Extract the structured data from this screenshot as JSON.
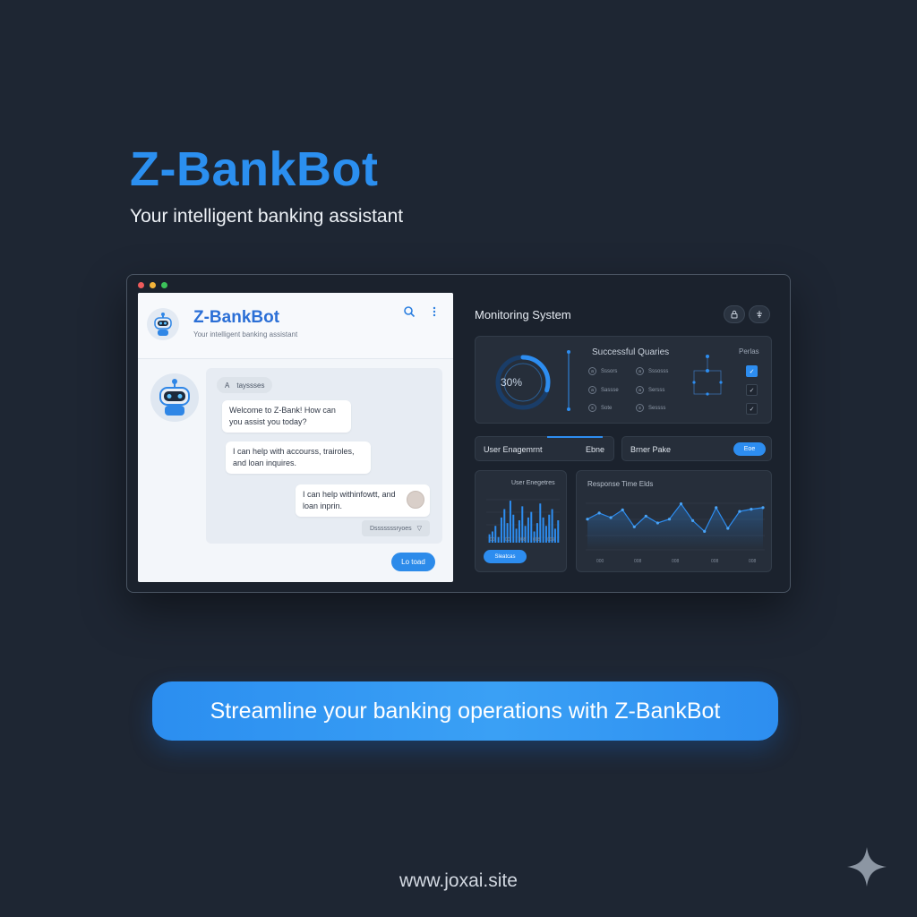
{
  "hero": {
    "title": "Z-BankBot",
    "subtitle": "Your intelligent banking assistant"
  },
  "window": {
    "traffic_light_colors": [
      "#ee5b5b",
      "#f3b43a",
      "#3cc25a"
    ]
  },
  "chat": {
    "title": "Z-BankBot",
    "subtitle": "Your intelligent banking assistant",
    "tag_icon": "A",
    "tag_label": "tayssses",
    "messages": [
      {
        "from": "bot",
        "text": "Welcome to Z-Bank! How can you assist you today?"
      },
      {
        "from": "bot",
        "text": "I can help with accourss, trairoles, and loan inquires."
      },
      {
        "from": "user",
        "text": "I can help withinfowtt, and loan inprin."
      }
    ],
    "status_label": "Dsssssssryoes",
    "status_chevron": "▽",
    "send_label": "Lo toad"
  },
  "monitor": {
    "title": "Monitoring System",
    "queries_card": {
      "title": "Successful Quaries",
      "side_label": "Perlas",
      "gauge_value": "30%",
      "gauge_fraction": 0.3,
      "left_items": [
        {
          "icon": "a",
          "label": "Sssors"
        },
        {
          "icon": "a",
          "label": "Sassse"
        },
        {
          "icon": "s",
          "label": "Sote"
        }
      ],
      "right_items": [
        {
          "icon": "a",
          "label": "Sssosss"
        },
        {
          "icon": "a",
          "label": "Sersss"
        },
        {
          "icon": "s",
          "label": "Sessss"
        }
      ]
    },
    "engagement_strip": {
      "label": "User Enagemrnt",
      "value": "Ebne"
    },
    "error_strip": {
      "label": "Brner Pake",
      "button": "Eoe"
    },
    "engagement_chart": {
      "title": "User Enegetres",
      "button": "Sleatcas",
      "axis_labels": [
        "00",
        "00",
        "008",
        "008",
        "009"
      ]
    },
    "response_chart": {
      "title": "Response Time Elds",
      "axis_labels": [
        "000",
        "008",
        "008",
        "008",
        "008"
      ]
    }
  },
  "chart_data": [
    {
      "type": "bar",
      "title": "User Enegetres",
      "values": [
        3,
        4,
        6,
        2,
        9,
        12,
        7,
        15,
        10,
        5,
        8,
        13,
        6,
        9,
        11,
        4,
        7,
        14,
        9,
        6,
        10,
        12,
        5,
        8
      ],
      "ylim": [
        0,
        16
      ]
    },
    {
      "type": "line",
      "title": "Response Time Elds",
      "values": [
        40,
        48,
        42,
        52,
        30,
        44,
        35,
        40,
        60,
        38,
        24,
        55,
        28,
        50,
        53,
        55
      ],
      "ylim": [
        0,
        70
      ]
    }
  ],
  "cta": {
    "label": "Streamline your banking operations with Z-BankBot"
  },
  "footer": {
    "url": "www.joxai.site"
  }
}
